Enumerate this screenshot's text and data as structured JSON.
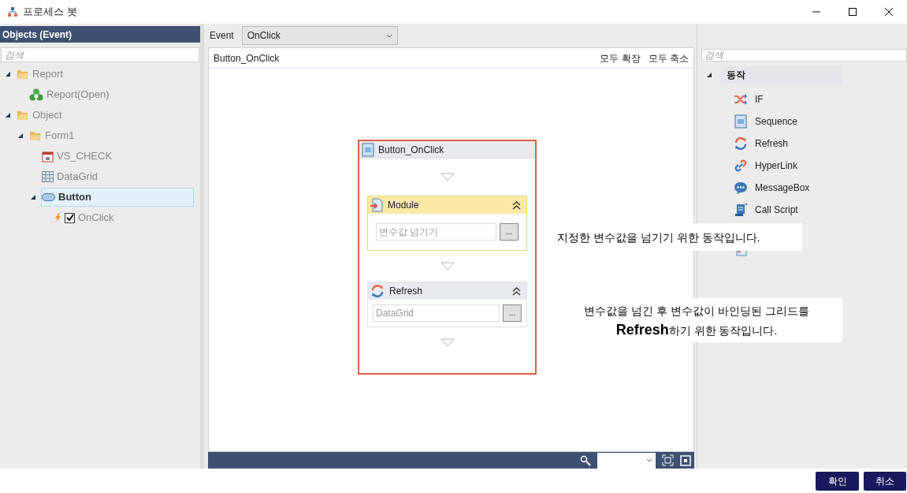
{
  "window": {
    "title": "프로세스 봇"
  },
  "objects_panel": {
    "title": "Objects (Event)",
    "search": {
      "placeholder": "검색"
    },
    "tree": [
      {
        "label": "Report",
        "kind": "folder",
        "expanded": true,
        "selected": false,
        "children": [
          {
            "label": "Report(Open)",
            "kind": "report",
            "selected": false
          }
        ]
      },
      {
        "label": "Object",
        "kind": "folder",
        "expanded": true,
        "selected": false,
        "children": [
          {
            "label": "Form1",
            "kind": "folder",
            "expanded": true,
            "selected": false,
            "children": [
              {
                "label": "VS_CHECK",
                "kind": "calendar",
                "selected": false
              },
              {
                "label": "DataGrid",
                "kind": "grid",
                "selected": false
              },
              {
                "label": "Button",
                "kind": "button",
                "expanded": true,
                "selected": true,
                "children": [
                  {
                    "label": "OnClick",
                    "kind": "event",
                    "checked": true,
                    "selected": false
                  }
                ]
              }
            ]
          }
        ]
      }
    ]
  },
  "event_bar": {
    "label": "Event",
    "value": "OnClick"
  },
  "canvas": {
    "title": "Button_OnClick",
    "actions": [
      "모두 확장",
      "모두 축소"
    ],
    "flow": {
      "title": "Button_OnClick",
      "steps": [
        {
          "title": "Module",
          "kind": "module",
          "highlighted": true,
          "placeholder": "변수값 넘기기",
          "button": "..."
        },
        {
          "title": "Refresh",
          "kind": "refresh",
          "highlighted": false,
          "placeholder": "DataGrid",
          "button": "..."
        }
      ]
    }
  },
  "palette": {
    "search": {
      "placeholder": "검색"
    },
    "group": "동작",
    "items": [
      {
        "label": "IF",
        "kind": "if"
      },
      {
        "label": "Sequence",
        "kind": "sequence"
      },
      {
        "label": "Refresh",
        "kind": "refresh"
      },
      {
        "label": "HyperLink",
        "kind": "link"
      },
      {
        "label": "MessageBox",
        "kind": "message"
      },
      {
        "label": "Call Script",
        "kind": "script"
      }
    ]
  },
  "callouts": [
    {
      "lines": [
        "지정한 변수값을 넘기기 위한 동작입니다."
      ]
    },
    {
      "lines": [
        "변수값을 넘긴 후 변수값이 바인딩된 그리드를",
        "**Refresh**하기 위한 동작입니다."
      ]
    }
  ],
  "buttons": [
    "확인",
    "취소"
  ]
}
